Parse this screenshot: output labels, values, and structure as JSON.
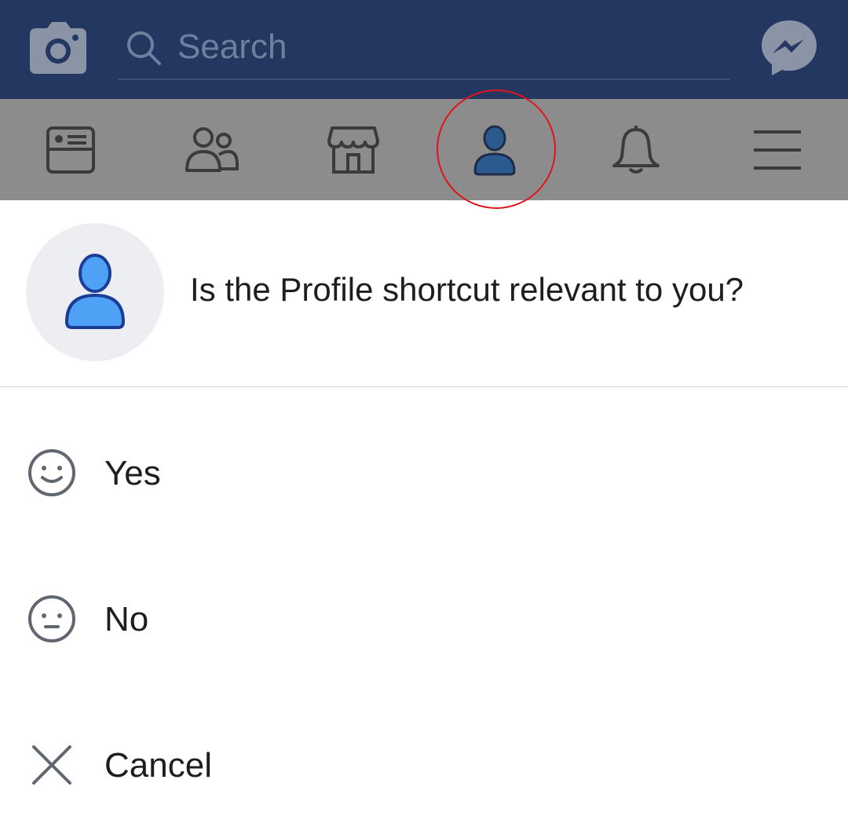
{
  "header": {
    "camera_icon": "camera-icon",
    "search_icon": "search-icon",
    "search_placeholder": "Search",
    "messenger_icon": "messenger-icon",
    "colors": {
      "header_bg": "#243761",
      "icon_gray": "#8b93a6"
    }
  },
  "nav": {
    "tabs": [
      {
        "name": "news-feed",
        "icon": "news-feed-icon"
      },
      {
        "name": "friends",
        "icon": "friends-icon"
      },
      {
        "name": "marketplace",
        "icon": "marketplace-icon"
      },
      {
        "name": "profile",
        "icon": "profile-icon",
        "active": true
      },
      {
        "name": "notifications",
        "icon": "bell-icon"
      },
      {
        "name": "menu",
        "icon": "menu-icon"
      }
    ],
    "colors": {
      "overlay_bg": "#8c8c8c",
      "highlight_ring": "#e0141b"
    }
  },
  "prompt": {
    "question": "Is the Profile shortcut relevant to you?",
    "icon": "profile-icon"
  },
  "options": [
    {
      "label": "Yes",
      "icon": "smile-icon"
    },
    {
      "label": "No",
      "icon": "neutral-face-icon"
    },
    {
      "label": "Cancel",
      "icon": "close-icon"
    }
  ]
}
